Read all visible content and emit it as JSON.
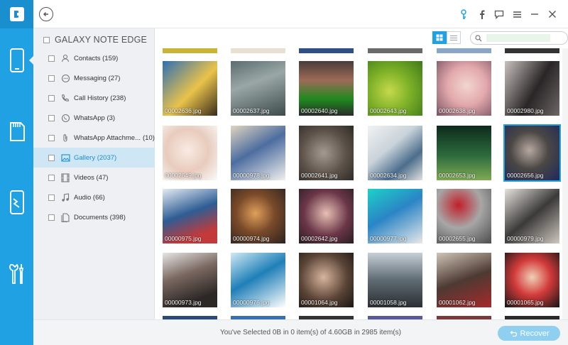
{
  "app": {
    "accent": "#1fa1e4",
    "rail_dark": "#1a8fd0"
  },
  "rail": {
    "items": [
      {
        "icon": "phone-icon"
      },
      {
        "icon": "sd-card-icon"
      },
      {
        "icon": "phone-repair-icon"
      },
      {
        "icon": "tools-icon"
      }
    ]
  },
  "topbar": {
    "icons": [
      "key-icon",
      "facebook-icon",
      "feedback-icon",
      "menu-icon",
      "minimize-icon",
      "close-icon"
    ]
  },
  "sidebar": {
    "device_name": "GALAXY NOTE EDGE",
    "items": [
      {
        "label": "Contacts (159)",
        "icon": "contacts-icon"
      },
      {
        "label": "Messaging (27)",
        "icon": "message-icon"
      },
      {
        "label": "Call History (238)",
        "icon": "call-icon"
      },
      {
        "label": "WhatsApp (3)",
        "icon": "whatsapp-icon"
      },
      {
        "label": "WhatsApp Attachme...",
        "count": "(10)",
        "icon": "attachment-icon"
      },
      {
        "label": "Gallery (2037)",
        "icon": "gallery-icon",
        "active": true
      },
      {
        "label": "Videos (47)",
        "icon": "video-icon"
      },
      {
        "label": "Audio (66)",
        "icon": "audio-icon"
      },
      {
        "label": "Documents (398)",
        "icon": "document-icon"
      }
    ]
  },
  "search": {
    "placeholder": ""
  },
  "grid": {
    "rows": [
      [
        {
          "cap": "00002636.jpg",
          "bg": "linear-gradient(135deg,#2f6fb3,#e9c34a 55%,#3a2b1b)"
        },
        {
          "cap": "00002637.jpg",
          "bg": "linear-gradient(160deg,#5a6c70,#9aa7a6 40%,#3e4b4c)"
        },
        {
          "cap": "00002640.jpg",
          "bg": "linear-gradient(180deg,#4a3b3a,#9d6b57 35%,#1e8a1e 70%,#2b2b2b)"
        },
        {
          "cap": "00002643.jpg",
          "bg": "radial-gradient(circle at 40% 55%,#c6d84d,#7fb228 45%,#3e7a1a)"
        },
        {
          "cap": "00002638.jpg",
          "bg": "radial-gradient(circle at 55% 45%,#f1d6cf,#e3a9ad 45%,#7a5363)"
        },
        {
          "cap": "00002980.jpg",
          "bg": "linear-gradient(120deg,#c9c2c0,#2a2526 55%,#6d6767)"
        }
      ],
      [
        {
          "cap": "00002649.jpg",
          "bg": "radial-gradient(circle at 45% 45%,#f9ebe3,#e8cbbd 50%,#fafafa)"
        },
        {
          "cap": "00000978.jpg",
          "bg": "linear-gradient(150deg,#e1d4bf,#4d6da0 45%,#f1f0ee)"
        },
        {
          "cap": "00002641.jpg",
          "bg": "radial-gradient(circle at 45% 50%,#a59a92,#5d5249 55%,#2f2a26)"
        },
        {
          "cap": "00002634.jpg",
          "bg": "linear-gradient(140deg,#f2f2f2,#c9d3da 40%,#4c6d8c 70%,#e0e0e0)"
        },
        {
          "cap": "00002653.jpg",
          "bg": "linear-gradient(180deg,#0d2b1c,#2d6b3d 55%,#7faa52)"
        },
        {
          "cap": "00002656.jpg",
          "bg": "radial-gradient(circle at 45% 45%,#b6a8a1,#4b4744 45%,#1f2a5b)",
          "sel": true
        }
      ],
      [
        {
          "cap": "00000975.jpg",
          "bg": "linear-gradient(160deg,#e4ebf2,#2e5d94 45%,#c23a3a 80%)"
        },
        {
          "cap": "00000974.jpg",
          "bg": "radial-gradient(circle at 45% 45%,#e0a05a,#7a4a2a 45%,#2b2220)"
        },
        {
          "cap": "00002642.jpg",
          "bg": "radial-gradient(circle at 50% 45%,#e7bfb4,#6a3648 55%,#2a1d22)"
        },
        {
          "cap": "00000977.jpg",
          "bg": "linear-gradient(150deg,#1dd1c8,#2a85c6 45%,#e8e8e8)"
        },
        {
          "cap": "00002655.jpg",
          "bg": "radial-gradient(circle at 40% 30%,#c21f2a,#a7a7a7 45%,#4d4d4d)"
        },
        {
          "cap": "00000979.jpg",
          "bg": "linear-gradient(140deg,#e6e2dd,#3b3a39 50%,#cfc8c0)"
        }
      ],
      [
        {
          "cap": "00000973.jpg",
          "bg": "linear-gradient(160deg,#e6e6e6,#7a6760 40%,#2c2826 80%)"
        },
        {
          "cap": "00000976.jpg",
          "bg": "linear-gradient(150deg,#cfeaf4,#1f7fb8 45%,#ffffff)"
        },
        {
          "cap": "00001064.jpg",
          "bg": "radial-gradient(circle at 45% 45%,#d7b49d,#5a4436 55%,#1c1612)"
        },
        {
          "cap": "00001058.jpg",
          "bg": "linear-gradient(180deg,#c7ced6,#5f6b73 50%,#2b2f33)"
        },
        {
          "cap": "00001062.jpg",
          "bg": "linear-gradient(160deg,#cfc4b6,#4d3a33 50%,#a52a2a)"
        },
        {
          "cap": "00001065.jpg",
          "bg": "radial-gradient(circle at 50% 45%,#f0d0b6,#d23a3a 45%,#151515)"
        }
      ]
    ]
  },
  "footer": {
    "status": "You've Selected 0B in 0 item(s) of 4.60GB in 2985 item(s)",
    "recover_label": "Recover"
  }
}
